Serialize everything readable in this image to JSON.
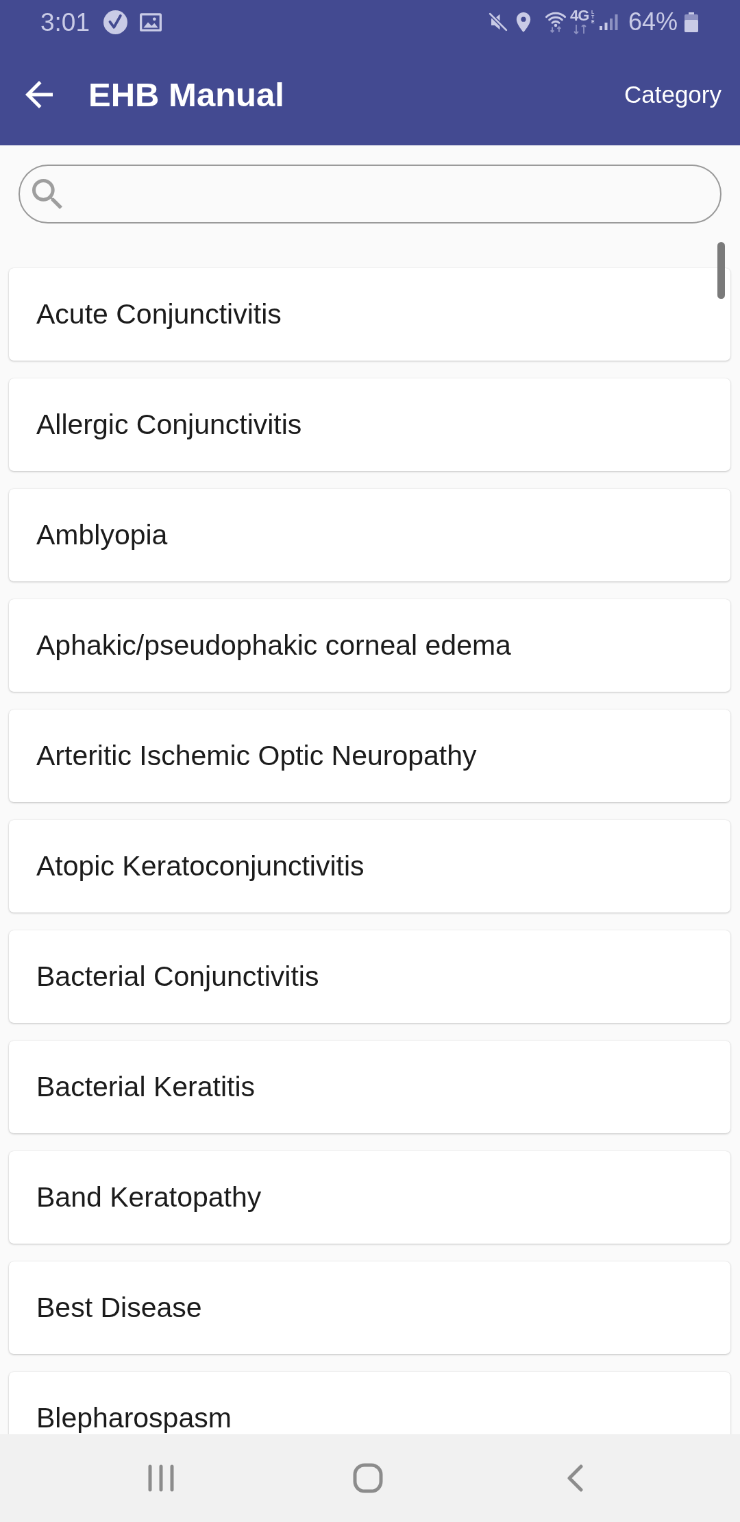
{
  "status_bar": {
    "time": "3:01",
    "network": "4G",
    "network_sub": "LTE",
    "battery": "64%"
  },
  "app_bar": {
    "title": "EHB Manual",
    "action": "Category"
  },
  "topics": [
    "Acute Conjunctivitis",
    "Allergic Conjunctivitis",
    "Amblyopia",
    "Aphakic/pseudophakic corneal edema",
    "Arteritic Ischemic Optic Neuropathy",
    "Atopic Keratoconjunctivitis",
    "Bacterial Conjunctivitis",
    "Bacterial Keratitis",
    "Band Keratopathy",
    "Best Disease",
    "Blepharospasm"
  ]
}
